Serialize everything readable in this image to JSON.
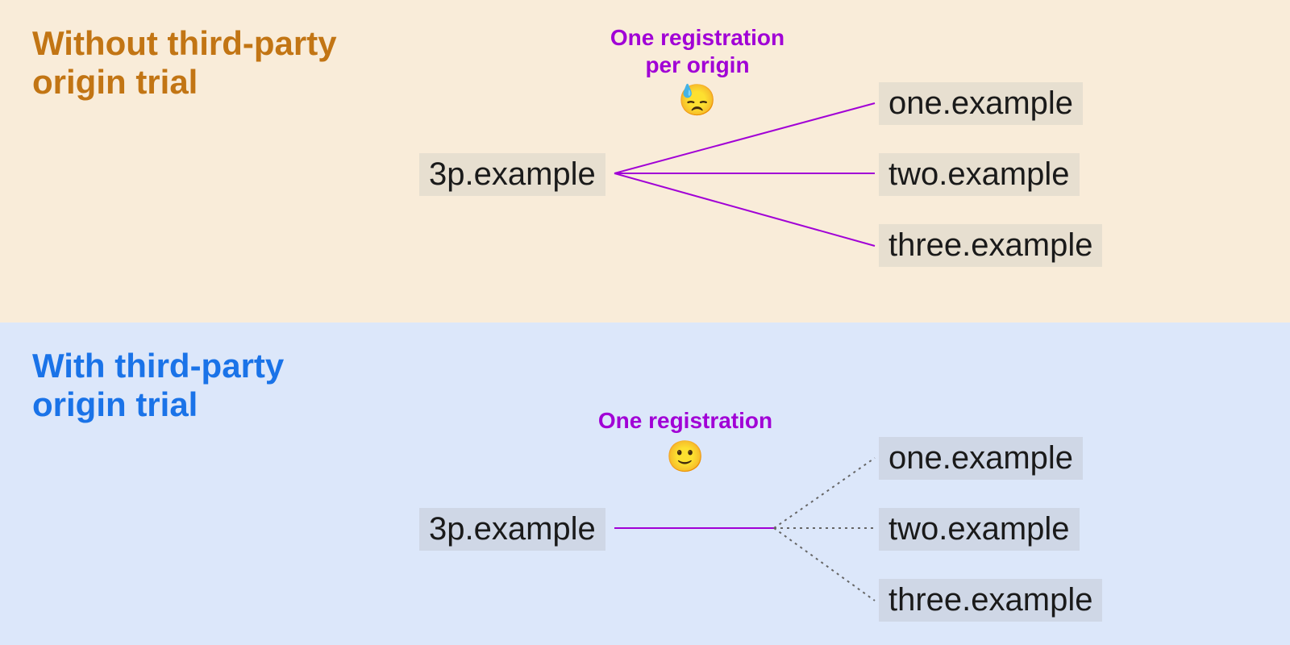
{
  "panels": {
    "top": {
      "heading": "Without third-party origin trial",
      "caption": "One registration per origin",
      "emoji": "😓",
      "source": "3p.example",
      "targets": [
        "one.example",
        "two.example",
        "three.example"
      ]
    },
    "bottom": {
      "heading": "With third-party origin trial",
      "caption": "One registration",
      "emoji": "🙂",
      "source": "3p.example",
      "targets": [
        "one.example",
        "two.example",
        "three.example"
      ]
    }
  },
  "colors": {
    "topBg": "#f9ecd9",
    "bottomBg": "#dce7fa",
    "headingTop": "#c27514",
    "headingBottom": "#1a73e8",
    "accent": "#a100d6",
    "lineSolid": "#a100d6",
    "lineDotted": "#666666"
  }
}
